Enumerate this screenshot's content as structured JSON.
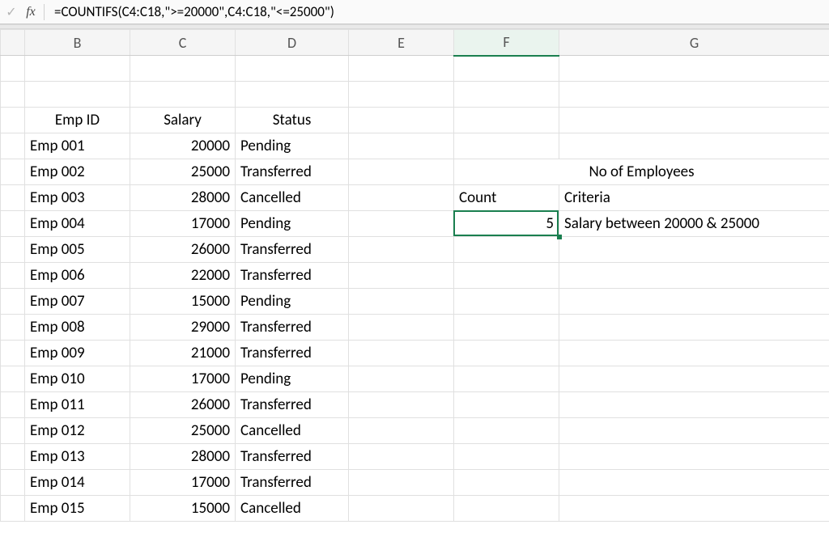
{
  "formula_bar": {
    "check_glyph": "✓",
    "fx_label": "fx",
    "formula": "=COUNTIFS(C4:C18,\">=20000\",C4:C18,\"<=25000\")"
  },
  "column_headers": [
    "B",
    "C",
    "D",
    "E",
    "F",
    "G"
  ],
  "active_column_index": 4,
  "table": {
    "headers": {
      "emp_id": "Emp ID",
      "salary": "Salary",
      "status": "Status"
    },
    "rows": [
      {
        "id": "Emp 001",
        "salary": "20000",
        "status": "Pending"
      },
      {
        "id": "Emp 002",
        "salary": "25000",
        "status": "Transferred"
      },
      {
        "id": "Emp 003",
        "salary": "28000",
        "status": "Cancelled"
      },
      {
        "id": "Emp 004",
        "salary": "17000",
        "status": "Pending"
      },
      {
        "id": "Emp 005",
        "salary": "26000",
        "status": "Transferred"
      },
      {
        "id": "Emp 006",
        "salary": "22000",
        "status": "Transferred"
      },
      {
        "id": "Emp 007",
        "salary": "15000",
        "status": "Pending"
      },
      {
        "id": "Emp 008",
        "salary": "29000",
        "status": "Transferred"
      },
      {
        "id": "Emp 009",
        "salary": "21000",
        "status": "Transferred"
      },
      {
        "id": "Emp 010",
        "salary": "17000",
        "status": "Pending"
      },
      {
        "id": "Emp 011",
        "salary": "26000",
        "status": "Transferred"
      },
      {
        "id": "Emp 012",
        "salary": "25000",
        "status": "Cancelled"
      },
      {
        "id": "Emp 013",
        "salary": "28000",
        "status": "Transferred"
      },
      {
        "id": "Emp 014",
        "salary": "17000",
        "status": "Transferred"
      },
      {
        "id": "Emp 015",
        "salary": "15000",
        "status": "Cancelled"
      }
    ]
  },
  "summary": {
    "title": "No of Employees",
    "count_label": "Count",
    "criteria_label": "Criteria",
    "count_value": "5",
    "criteria_value": "Salary between 20000 & 25000"
  },
  "colors": {
    "accent": "#1a7f4f",
    "header_fill": "#c0c0c0",
    "green_fill": "#c6e0b4"
  }
}
